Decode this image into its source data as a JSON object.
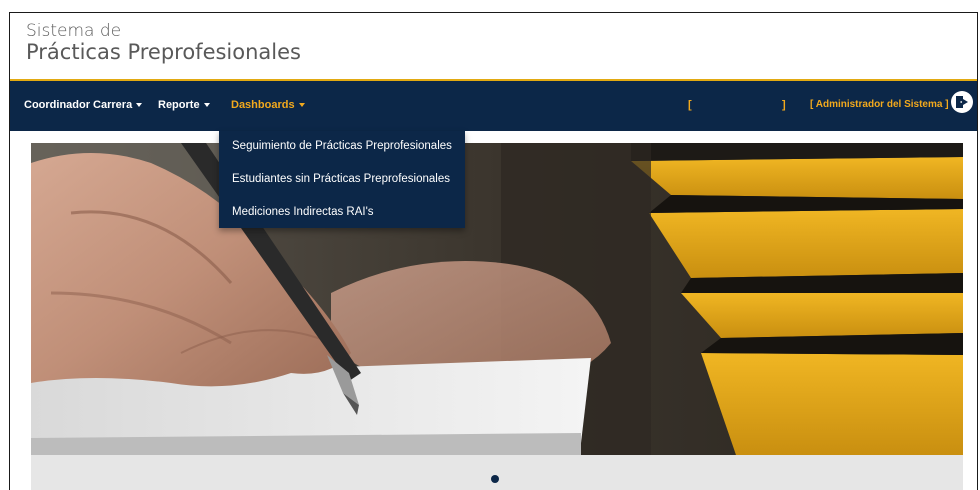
{
  "brand": {
    "line1": "Sistema de",
    "line2": "Prácticas Preprofesionales"
  },
  "nav": {
    "items": [
      {
        "label": "Coordinador Carrera"
      },
      {
        "label": "Reporte"
      },
      {
        "label": "Dashboards"
      }
    ],
    "bracket_open": "[",
    "bracket_close": "]",
    "user_label": "[ Administrador del Sistema ]",
    "logout_icon": "logout-icon"
  },
  "dropdown": {
    "items": [
      {
        "label": "Seguimiento de Prácticas Preprofesionales"
      },
      {
        "label": "Estudiantes sin Prácticas Preprofesionales"
      },
      {
        "label": "Mediciones Indirectas RAI's"
      }
    ]
  },
  "carousel": {
    "slide_image": "hand-writing-with-fountain-pen",
    "indicator_count": 1
  },
  "colors": {
    "navbar": "#0c2748",
    "accent": "#f2a91d",
    "divider": "#e2aa12"
  }
}
